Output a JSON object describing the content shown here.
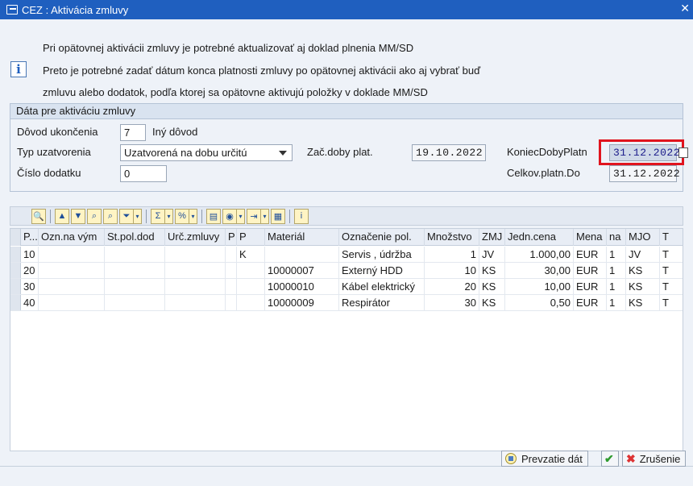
{
  "window": {
    "title": "CEZ : Aktivácia zmluvy",
    "close_glyph": "✕"
  },
  "message": {
    "icon": "info-icon",
    "lines": [
      "Pri opätovnej aktivácii zmluvy je potrebné aktualizovať aj doklad plnenia MM/SD",
      "Preto je potrebné zadať dátum konca platnosti zmluvy po opätovnej aktivácii ako aj vybrať buď",
      "zmluvu alebo dodatok, podľa ktorej sa opätovne aktivujú položky v doklade MM/SD"
    ]
  },
  "form": {
    "group_title": "Dáta pre aktiváciu zmluvy",
    "reason_label": "Dôvod ukončenia",
    "reason_code": "7",
    "reason_text": "Iný dôvod",
    "type_label": "Typ uzatvorenia",
    "type_value": "Uzatvorená na dobu určitú",
    "start_label": "Zač.doby plat.",
    "start_value": "19.10.2022",
    "end_label": "KoniecDobyPlatn",
    "end_value": "31.12.2022",
    "addendum_label": "Číslo dodatku",
    "addendum_value": "0",
    "total_label": "Celkov.platn.Do",
    "total_value": "31.12.2022"
  },
  "table": {
    "headers": [
      "P...",
      "Ozn.na vým",
      "St.pol.dod",
      "Urč.zmluvy",
      "P",
      "P",
      "Materiál",
      "Označenie pol.",
      "Množstvo",
      "ZMJ",
      "Jedn.cena",
      "Mena",
      "na",
      "MJO",
      "T"
    ],
    "rows": [
      [
        "10",
        "",
        "",
        "",
        "",
        "K",
        "",
        "Servis , údržba",
        "1",
        "JV",
        "1.000,00",
        "EUR",
        "1",
        "JV",
        "T"
      ],
      [
        "20",
        "",
        "",
        "",
        "",
        "",
        "10000007",
        "Externý HDD",
        "10",
        "KS",
        "30,00",
        "EUR",
        "1",
        "KS",
        "T"
      ],
      [
        "30",
        "",
        "",
        "",
        "",
        "",
        "10000010",
        "Kábel elektrický",
        "20",
        "KS",
        "10,00",
        "EUR",
        "1",
        "KS",
        "T"
      ],
      [
        "40",
        "",
        "",
        "",
        "",
        "",
        "10000009",
        "Respirátor",
        "30",
        "KS",
        "0,50",
        "EUR",
        "1",
        "KS",
        "T"
      ]
    ]
  },
  "footer": {
    "takeover_label": "Prevzatie dát",
    "cancel_label": "Zrušenie"
  },
  "colors": {
    "title_bar": "#1f5fbf",
    "highlight": "#e0141e"
  }
}
